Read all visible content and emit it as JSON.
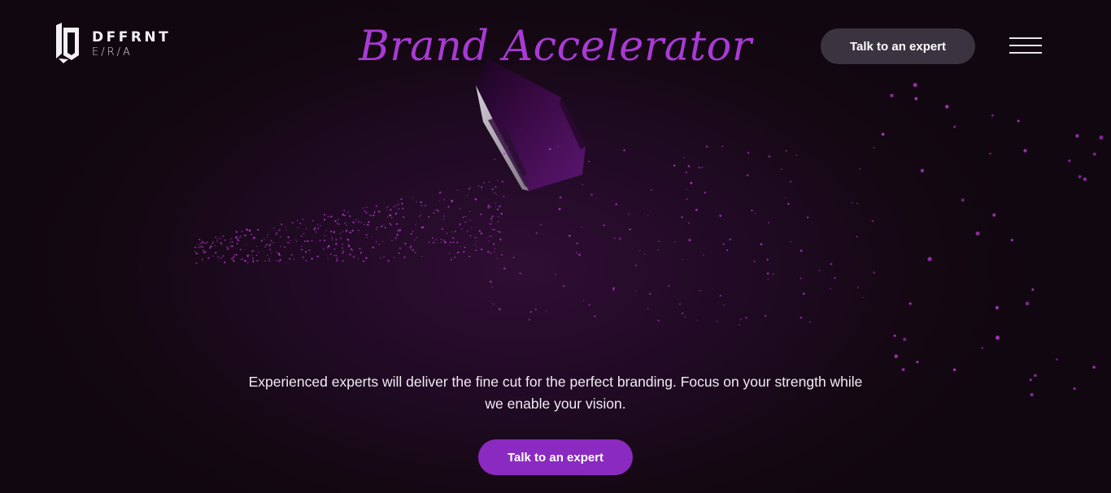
{
  "header": {
    "logo": {
      "name": "DFFRNT",
      "sub": "E/R/A"
    },
    "cta_label": "Talk to an expert",
    "menu_icon": "hamburger-menu-icon"
  },
  "hero": {
    "title": "Brand Accelerator",
    "description": "Experienced experts will deliver the fine cut for the perfect branding. Focus on your strength while we enable your vision.",
    "cta_label": "Talk to an expert"
  },
  "colors": {
    "title": "#a83ad4",
    "primary_button": "#8b2ac0",
    "secondary_button": "#3a3340",
    "background": "#1a0a1c",
    "particles": "#c13bd8"
  }
}
